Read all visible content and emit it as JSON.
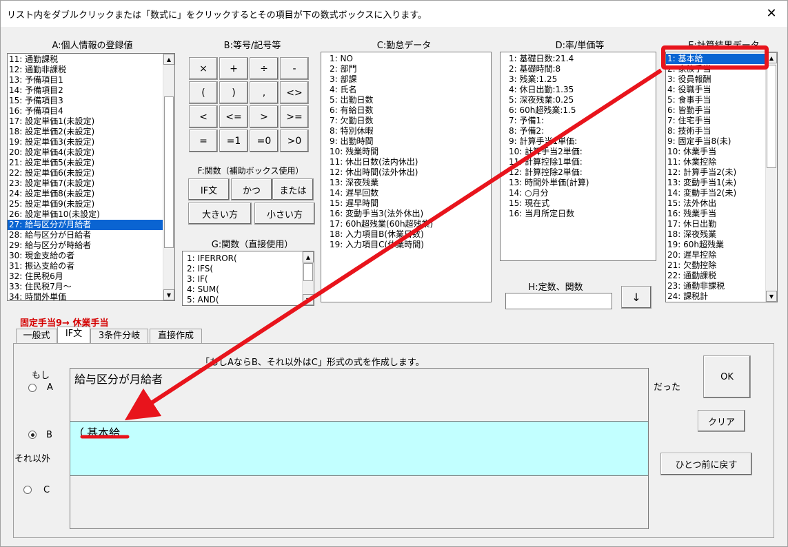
{
  "window": {
    "title": "リスト内をダブルクリックまたは「数式に」をクリックするとその項目が下の数式ボックスに入ります。",
    "close": "✕"
  },
  "labels": {
    "a": "A:個人情報の登録値",
    "b": "B:等号/記号等",
    "c": "C:勤怠データ",
    "d": "D:率/単価等",
    "e": "E:計算結果データ",
    "f": "F:関数（補助ボックス使用）",
    "g": "G:関数（直接使用）",
    "h": "H:定数、関数"
  },
  "listA": [
    "11: 通勤課税",
    "12: 通勤非課税",
    "13: 予備項目1",
    "14: 予備項目2",
    "15: 予備項目3",
    "16: 予備項目4",
    "17: 設定単価1(未設定)",
    "18: 設定単価2(未設定)",
    "19: 設定単価3(未設定)",
    "20: 設定単価4(未設定)",
    "21: 設定単価5(未設定)",
    "22: 設定単価6(未設定)",
    "23: 設定単価7(未設定)",
    "24: 設定単価8(未設定)",
    "25: 設定単価9(未設定)",
    "26: 設定単価10(未設定)",
    "27: 給与区分が月給者",
    "28: 給与区分が日給者",
    "29: 給与区分が時給者",
    "30: 現金支給の者",
    "31: 振込支給の者",
    "32: 住民税6月",
    "33: 住民税7月～",
    "34: 時間外単価"
  ],
  "listC": [
    "1: NO",
    "2: 部門",
    "3: 部課",
    "4: 氏名",
    "5: 出勤日数",
    "6: 有給日数",
    "7: 欠勤日数",
    "8: 特別休暇",
    "9: 出勤時間",
    "10: 残業時間",
    "11: 休出日数(法内休出)",
    "12: 休出時間(法外休出)",
    "13: 深夜残業",
    "14: 遅早回数",
    "15: 遅早時間",
    "16: 変動手当3(法外休出)",
    "17: 60h超残業(60h超残業)",
    "18: 入力項目B(休業日数)",
    "19: 入力項目C(休業時間)"
  ],
  "listD": [
    "1: 基礎日数:21.4",
    "2: 基礎時間:8",
    "3: 残業:1.25",
    "4: 休日出勤:1.35",
    "5: 深夜残業:0.25",
    "6: 60h超残業:1.5",
    "7: 予備1:",
    "8: 予備2:",
    "9: 計算手当1単価:",
    "10: 計算手当2単価:",
    "11: 計算控除1単価:",
    "12: 計算控除2単価:",
    "13: 時間外単価(計算)",
    "14: ○月分",
    "15: 現在式",
    "16: 当月所定日数"
  ],
  "listE": [
    "1: 基本給",
    "2: 家族手当",
    "3: 役員報酬",
    "4: 役職手当",
    "5: 食事手当",
    "6: 皆勤手当",
    "7: 住宅手当",
    "8: 技術手当",
    "9: 固定手当8(未)",
    "10: 休業手当",
    "11: 休業控除",
    "12: 計算手当2(未)",
    "13: 変動手当1(未)",
    "14: 変動手当2(未)",
    "15: 法外休出",
    "16: 残業手当",
    "17: 休日出勤",
    "18: 深夜残業",
    "19: 60h超残業",
    "20: 遅早控除",
    "21: 欠勤控除",
    "22: 通勤課税",
    "23: 通勤非課税",
    "24: 課税計"
  ],
  "listG": [
    "1: IFERROR(",
    "2: IFS(",
    "3: IF(",
    "4: SUM(",
    "5: AND("
  ],
  "symbols": [
    "×",
    "+",
    "÷",
    "-",
    "(",
    ")",
    ",",
    "<>",
    "<",
    "<=",
    ">",
    ">=",
    "=",
    "=1",
    "=0",
    ">0"
  ],
  "funcButtons": [
    "IF文",
    "かつ",
    "または",
    "大きい方",
    "小さい方"
  ],
  "arrowDown": "↓",
  "status": "固定手当9→ 休業手当",
  "tabs": [
    "一般式",
    "IF文",
    "3条件分岐",
    "直接作成"
  ],
  "panel": {
    "description": "「もしAならB、それ以外はC」形式の式を作成します。",
    "if_label": "もし",
    "radio_a": "A",
    "radio_b": "B",
    "radio_c": "C",
    "else_label": "それ以外",
    "then_label": "だった",
    "formula_a": "給与区分が月給者",
    "formula_b_prefix": "（",
    "formula_b_item": "基本給",
    "formula_c": "",
    "ok": "OK",
    "clear": "クリア",
    "undo": "ひとつ前に戻す"
  },
  "colors": {
    "selection": "#0a64d2",
    "annotation": "#e8141c",
    "formula_b_bg": "#c2ffff",
    "status_red": "#d40000"
  }
}
